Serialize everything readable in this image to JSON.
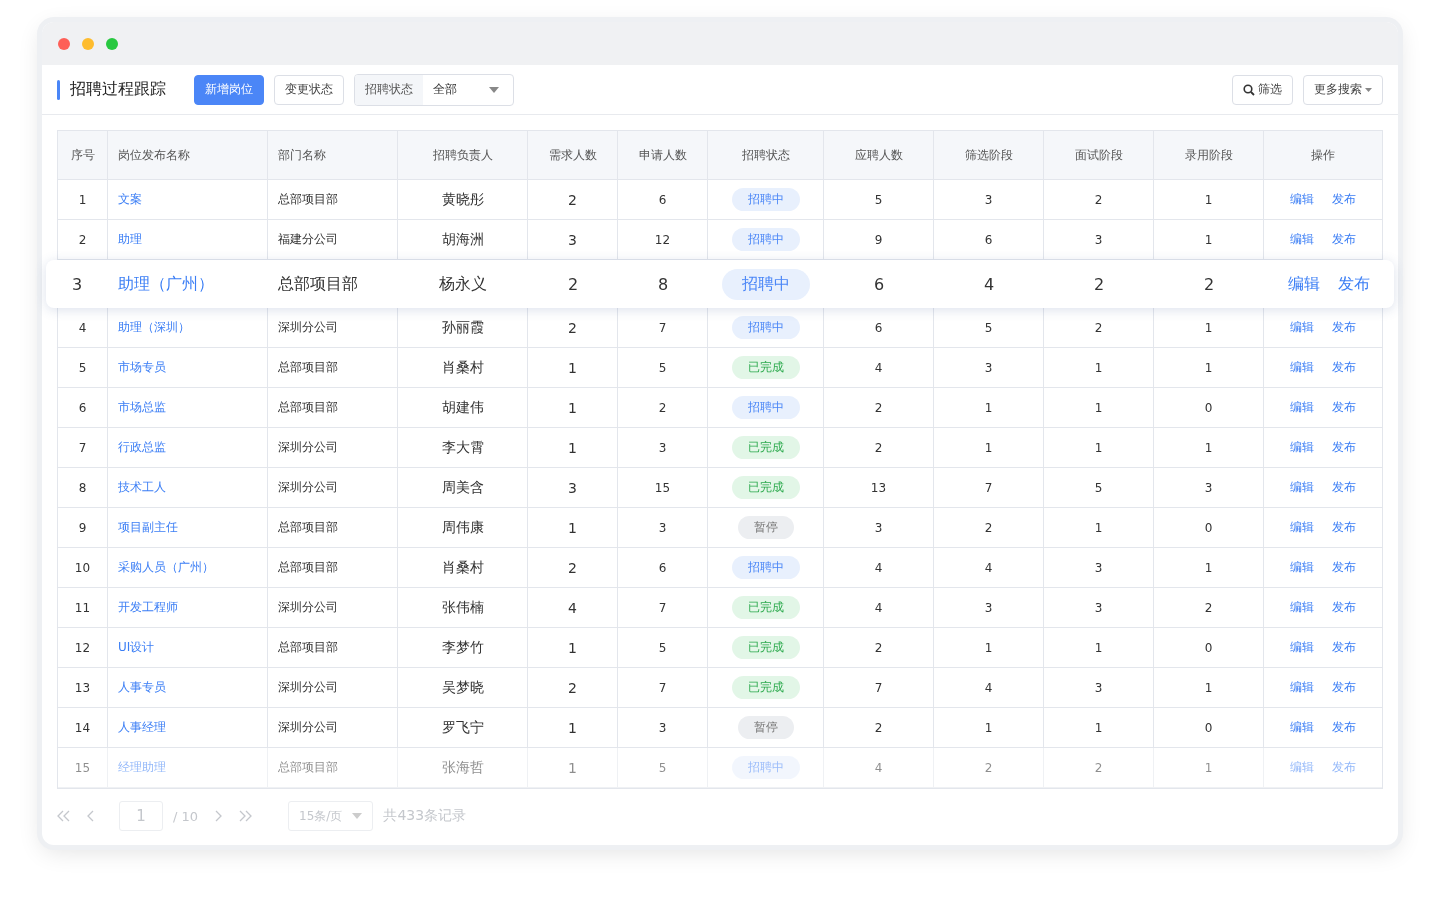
{
  "title": "招聘过程跟踪",
  "toolbar": {
    "add_button": "新增岗位",
    "change_button": "变更状态",
    "status_filter": {
      "label": "招聘状态",
      "value": "全部"
    },
    "filter_button": "筛选",
    "more_search": "更多搜索"
  },
  "table": {
    "columns": [
      "序号",
      "岗位发布名称",
      "部门名称",
      "招聘负责人",
      "需求人数",
      "申请人数",
      "招聘状态",
      "应聘人数",
      "筛选阶段",
      "面试阶段",
      "录用阶段",
      "操作"
    ],
    "rows": [
      {
        "no": "1",
        "position": "文案",
        "dept": "总部项目部",
        "owner": "黄晓彤",
        "need": "2",
        "apply": "6",
        "status": {
          "label": "招聘中",
          "kind": "recruiting"
        },
        "candidates": "5",
        "screening": "3",
        "interview": "2",
        "hired": "1",
        "edit": "编辑",
        "publish": "发布",
        "highlighted": false,
        "dimmed": false
      },
      {
        "no": "2",
        "position": "助理",
        "dept": "福建分公司",
        "owner": "胡海洲",
        "need": "3",
        "apply": "12",
        "status": {
          "label": "招聘中",
          "kind": "recruiting"
        },
        "candidates": "9",
        "screening": "6",
        "interview": "3",
        "hired": "1",
        "edit": "编辑",
        "publish": "发布",
        "highlighted": false,
        "dimmed": false
      },
      {
        "no": "3",
        "position": "助理（广州）",
        "dept": "总部项目部",
        "owner": "杨永义",
        "need": "2",
        "apply": "8",
        "status": {
          "label": "招聘中",
          "kind": "recruiting"
        },
        "candidates": "6",
        "screening": "4",
        "interview": "2",
        "hired": "2",
        "edit": "编辑",
        "publish": "发布",
        "highlighted": true,
        "dimmed": false
      },
      {
        "no": "4",
        "position": "助理（深圳）",
        "dept": "深圳分公司",
        "owner": "孙丽霞",
        "need": "2",
        "apply": "7",
        "status": {
          "label": "招聘中",
          "kind": "recruiting"
        },
        "candidates": "6",
        "screening": "5",
        "interview": "2",
        "hired": "1",
        "edit": "编辑",
        "publish": "发布",
        "highlighted": false,
        "dimmed": false
      },
      {
        "no": "5",
        "position": "市场专员",
        "dept": "总部项目部",
        "owner": "肖桑村",
        "need": "1",
        "apply": "5",
        "status": {
          "label": "已完成",
          "kind": "done"
        },
        "candidates": "4",
        "screening": "3",
        "interview": "1",
        "hired": "1",
        "edit": "编辑",
        "publish": "发布",
        "highlighted": false,
        "dimmed": false
      },
      {
        "no": "6",
        "position": "市场总监",
        "dept": "总部项目部",
        "owner": "胡建伟",
        "need": "1",
        "apply": "2",
        "status": {
          "label": "招聘中",
          "kind": "recruiting"
        },
        "candidates": "2",
        "screening": "1",
        "interview": "1",
        "hired": "0",
        "edit": "编辑",
        "publish": "发布",
        "highlighted": false,
        "dimmed": false
      },
      {
        "no": "7",
        "position": "行政总监",
        "dept": "深圳分公司",
        "owner": "李大霄",
        "need": "1",
        "apply": "3",
        "status": {
          "label": "已完成",
          "kind": "done"
        },
        "candidates": "2",
        "screening": "1",
        "interview": "1",
        "hired": "1",
        "edit": "编辑",
        "publish": "发布",
        "highlighted": false,
        "dimmed": false
      },
      {
        "no": "8",
        "position": "技术工人",
        "dept": "深圳分公司",
        "owner": "周美含",
        "need": "3",
        "apply": "15",
        "status": {
          "label": "已完成",
          "kind": "done"
        },
        "candidates": "13",
        "screening": "7",
        "interview": "5",
        "hired": "3",
        "edit": "编辑",
        "publish": "发布",
        "highlighted": false,
        "dimmed": false
      },
      {
        "no": "9",
        "position": "项目副主任",
        "dept": "总部项目部",
        "owner": "周伟康",
        "need": "1",
        "apply": "3",
        "status": {
          "label": "暂停",
          "kind": "paused"
        },
        "candidates": "3",
        "screening": "2",
        "interview": "1",
        "hired": "0",
        "edit": "编辑",
        "publish": "发布",
        "highlighted": false,
        "dimmed": false
      },
      {
        "no": "10",
        "position": "采购人员（广州）",
        "dept": "总部项目部",
        "owner": "肖桑村",
        "need": "2",
        "apply": "6",
        "status": {
          "label": "招聘中",
          "kind": "recruiting"
        },
        "candidates": "4",
        "screening": "4",
        "interview": "3",
        "hired": "1",
        "edit": "编辑",
        "publish": "发布",
        "highlighted": false,
        "dimmed": false
      },
      {
        "no": "11",
        "position": "开发工程师",
        "dept": "深圳分公司",
        "owner": "张伟楠",
        "need": "4",
        "apply": "7",
        "status": {
          "label": "已完成",
          "kind": "done"
        },
        "candidates": "4",
        "screening": "3",
        "interview": "3",
        "hired": "2",
        "edit": "编辑",
        "publish": "发布",
        "highlighted": false,
        "dimmed": false
      },
      {
        "no": "12",
        "position": "UI设计",
        "dept": "总部项目部",
        "owner": "李梦竹",
        "need": "1",
        "apply": "5",
        "status": {
          "label": "已完成",
          "kind": "done"
        },
        "candidates": "2",
        "screening": "1",
        "interview": "1",
        "hired": "0",
        "edit": "编辑",
        "publish": "发布",
        "highlighted": false,
        "dimmed": false
      },
      {
        "no": "13",
        "position": "人事专员",
        "dept": "深圳分公司",
        "owner": "吴梦晓",
        "need": "2",
        "apply": "7",
        "status": {
          "label": "已完成",
          "kind": "done"
        },
        "candidates": "7",
        "screening": "4",
        "interview": "3",
        "hired": "1",
        "edit": "编辑",
        "publish": "发布",
        "highlighted": false,
        "dimmed": false
      },
      {
        "no": "14",
        "position": "人事经理",
        "dept": "深圳分公司",
        "owner": "罗飞宁",
        "need": "1",
        "apply": "3",
        "status": {
          "label": "暂停",
          "kind": "paused"
        },
        "candidates": "2",
        "screening": "1",
        "interview": "1",
        "hired": "0",
        "edit": "编辑",
        "publish": "发布",
        "highlighted": false,
        "dimmed": false
      },
      {
        "no": "15",
        "position": "经理助理",
        "dept": "总部项目部",
        "owner": "张海哲",
        "need": "1",
        "apply": "5",
        "status": {
          "label": "招聘中",
          "kind": "recruiting"
        },
        "candidates": "4",
        "screening": "2",
        "interview": "2",
        "hired": "1",
        "edit": "编辑",
        "publish": "发布",
        "highlighted": false,
        "dimmed": true
      }
    ]
  },
  "pagination": {
    "page": "1",
    "total_pages": "/ 10",
    "page_size": "15条/页",
    "total": "共433条记录",
    "disabled": true
  }
}
